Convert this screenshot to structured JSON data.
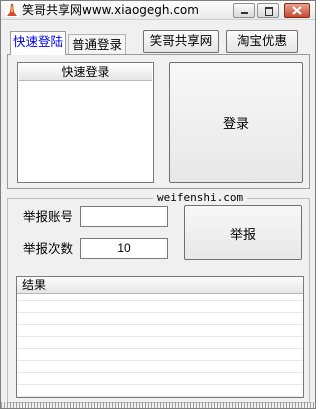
{
  "window": {
    "title": "笑哥共享网www.xiaogegh.com"
  },
  "tabs": [
    {
      "label": "快速登陆",
      "active": true
    },
    {
      "label": "普通登录",
      "active": false
    }
  ],
  "top_buttons": {
    "share_label": "笑哥共享网",
    "taobao_label": "淘宝优惠"
  },
  "quick_login": {
    "list_header": "快速登录",
    "login_label": "登录"
  },
  "report": {
    "group_title": "weifenshi.com",
    "account_label": "举报账号",
    "account_value": "",
    "times_label": "举报次数",
    "times_value": "10",
    "report_label": "举报",
    "result_header": "结果"
  },
  "colors": {
    "active_tab_text": "#0000ee",
    "close_button": "#c44a31",
    "window_bg": "#f0f0f0"
  }
}
